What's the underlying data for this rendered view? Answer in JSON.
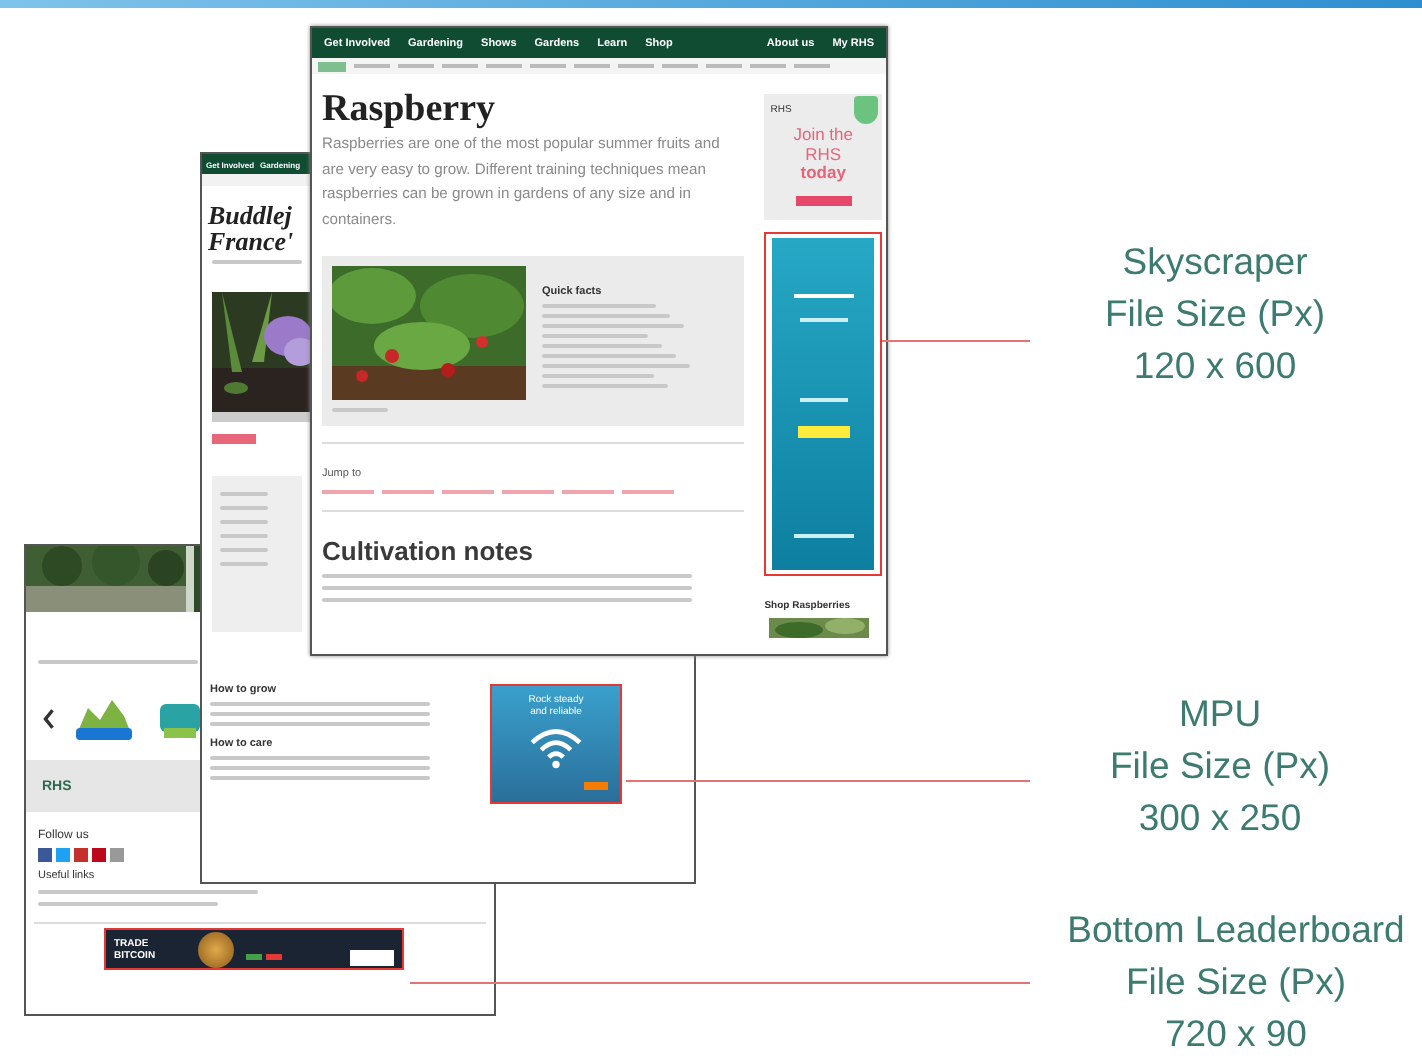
{
  "raspberry_page": {
    "nav": {
      "items": [
        "Get Involved",
        "Gardening",
        "Shows",
        "Gardens",
        "Learn",
        "Shop"
      ],
      "right_items": [
        "About us",
        "My RHS"
      ]
    },
    "title": "Raspberry",
    "intro": "Raspberries are one of the most popular summer fruits and are very easy to grow. Different training techniques mean raspberries can be grown in gardens of any size and in containers.",
    "quick_facts": {
      "heading": "Quick facts"
    },
    "jump_to": "Jump to",
    "section_heading": "Cultivation notes",
    "join_ad": {
      "logo": "RHS",
      "text": "Join the RHS **today**"
    },
    "shop_heading": "Shop Raspberries"
  },
  "buddleja_page": {
    "nav": [
      "Get Involved",
      "Gardening"
    ],
    "title_lines": [
      "Buddlej",
      "France'"
    ],
    "sections": [
      "How to grow",
      "How to care"
    ],
    "mpu_ad": {
      "text": "Rock steady and reliable"
    }
  },
  "home_page": {
    "logo": "RHS",
    "follow_heading": "Follow us",
    "links_heading": "Useful links",
    "leaderboard_ad": {
      "text": "TRADE BITCOIN"
    }
  },
  "callouts": [
    {
      "kind": "skyscraper",
      "title": "Skyscraper",
      "caption": "File Size (Px)",
      "size": "120 x 600"
    },
    {
      "kind": "mpu",
      "title": "MPU",
      "caption": "File Size (Px)",
      "size": "300 x 250"
    },
    {
      "kind": "leaderboard",
      "title": "Bottom Leaderboard",
      "caption": "File Size (Px)",
      "size": "720 x 90"
    }
  ]
}
